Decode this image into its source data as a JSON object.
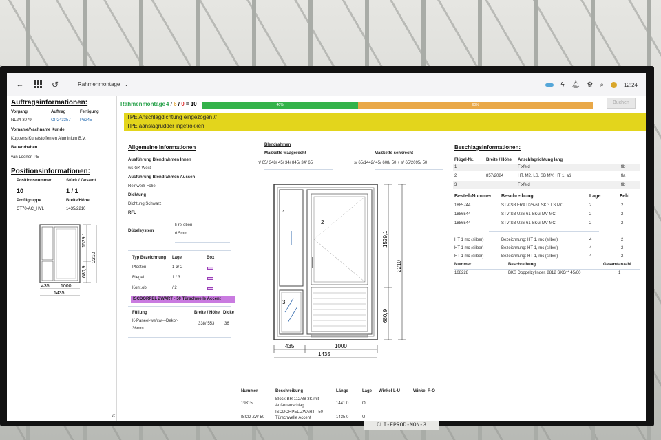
{
  "topbar": {
    "title": "Rahmenmontage",
    "time": "12:24",
    "icons": [
      "back-arrow-icon",
      "apps-grid-icon",
      "logo-icon",
      "chevron-down-icon",
      "key-icon",
      "bolt-icon",
      "bell-icon",
      "gear-icon",
      "search-icon",
      "avatar"
    ]
  },
  "left": {
    "auftrag_title": "Auftragsinformationen:",
    "vorgang_label": "Vorgang",
    "auftrag_label": "Auftrag",
    "fertigung_label": "Fertigung",
    "vorgang": "NL24-3079",
    "auftrag": "OP243357",
    "fertigung": "P6245",
    "kunde_label": "Vorname/Nachname Kunde",
    "kunde": "Kuppens Kunststoffen en Aluminium B.V.",
    "bauvorhaben_label": "Bauvorhaben",
    "bauvorhaben": "van Loenen PE",
    "position_title": "Positionsinformationen:",
    "posnr_label": "Positionsnummer",
    "stueck_label": "Stück / Gesamt",
    "posnr": "10",
    "stueck": "1 / 1",
    "profil_label": "Profilgruppe",
    "bh_label": "Breite/Höhe",
    "profil": "CT70-AC_HVL",
    "bh": "1435/2210",
    "dims": {
      "h1": "1529,1",
      "h2": "680,9",
      "total_h": "2210",
      "w1": "435",
      "w2": "1000",
      "total_w": "1435"
    }
  },
  "progress": {
    "label": "Rahmenmontage",
    "count_a": "4",
    "count_b": "6",
    "count_c": "0",
    "count_total": "10",
    "green_pct": 40,
    "green_text": "40%",
    "orange_text": "60%",
    "green_color": "#33b24a",
    "orange_color": "#e9a848",
    "buchen_label": "Buchen"
  },
  "banner": {
    "line1": "TPE Anschlagdichtung eingezogen //",
    "line2": "TPE aanslagrudder ingetrokken",
    "color": "#e3d51c"
  },
  "allgemein": {
    "title": "Allgemeine Informationen",
    "innen_label": "Ausführung Blendrahmen Innen",
    "innen": "ws-GK Weiß",
    "aussen_label": "Ausführung Blendrahmen Aussen",
    "aussen": "Reinweiß Folie",
    "dichtung_label": "Dichtung",
    "dichtung": "Dichtung Schwarz",
    "rfl_label": "RFL",
    "duebel_label": "Dübelsystem",
    "duebel_1": "li-re-oben",
    "duebel_2": "6,5mm",
    "typ_label": "Typ Bezeichnung",
    "lage_label": "Lage",
    "box_label": "Box",
    "rows": [
      {
        "typ": "Pfosten",
        "lage": "1-3/  2"
      },
      {
        "typ": "Riegel",
        "lage": "1  /  3"
      },
      {
        "typ": "Kont.ob",
        "lage": "/  2"
      }
    ],
    "purple_label": "ISCDORPEL ZWART - 50 Türschwelle Accent",
    "fuellung_label": "Füllung",
    "bh_label": "Breite / Höhe",
    "dicke_label": "Dicke",
    "fuellung_1": "K-Paneel-ws/cw---Dekor-",
    "fuellung_2": "36mm",
    "fuellung_bh": "338/ 553",
    "fuellung_dicke": "36"
  },
  "blendrahmen": {
    "title": "Blendrahmen",
    "waag_label": "Maßkette waagerecht",
    "senk_label": "Maßkette senkrecht",
    "waag": "h/ 65/ 348/ 45/ 34/ 845/ 34/ 65",
    "senk": "s/ 65/1442/ 45/ 608/ 50 + s/ 65/2095/ 50",
    "dims": {
      "h1": "1529,1",
      "h2": "680,9",
      "total_h": "2210",
      "w1": "435",
      "w2": "1000",
      "total_w": "1435",
      "f1": "1",
      "f2": "2",
      "f3": "3"
    }
  },
  "beschlag": {
    "title": "Beschlagsinformationen:",
    "h_fluegel": "Flügel-Nr.",
    "h_bh": "Breite / Höhe",
    "h_anschlag": "Anschlagrichtung lang",
    "rows1": [
      {
        "nr": "1",
        "bh": "",
        "anschlag": "Fixfeld",
        "x": "flb"
      },
      {
        "nr": "2",
        "bh": "857/2084",
        "anschlag": "HT, M2, LS, SB MV, HT 1, aö",
        "x": "fla"
      },
      {
        "nr": "3",
        "bh": "",
        "anschlag": "Fixfeld",
        "x": "flb"
      }
    ],
    "h_bestell": "Bestell-Nummer",
    "h_beschr": "Beschreibung",
    "h_lage": "Lage",
    "h_feld": "Feld",
    "rows2": [
      {
        "nr": "1885744",
        "beschr": "STV-SB FRA U26-61 SKG LS MC",
        "lage": "2",
        "feld": "2"
      },
      {
        "nr": "1886544",
        "beschr": "STV-SB U26-61 SKG MV MC",
        "lage": "2",
        "feld": "2"
      },
      {
        "nr": "1886544",
        "beschr": "STV-SB U26-61 SKG MV MC",
        "lage": "2",
        "feld": "2"
      }
    ],
    "rows3": [
      {
        "nr": "HT 1 mc (silber)",
        "beschr": "Bezeichnung: HT 1, mc (silber)",
        "lage": "4",
        "feld": "2"
      },
      {
        "nr": "HT 1 mc (silber)",
        "beschr": "Bezeichnung: HT 1, mc (silber)",
        "lage": "4",
        "feld": "2"
      },
      {
        "nr": "HT 1 mc (silber)",
        "beschr": "Bezeichnung: HT 1, mc (silber)",
        "lage": "4",
        "feld": "2"
      }
    ],
    "h_nummer": "Nummer",
    "h_beschr2": "Beschreibung",
    "h_gesamt": "Gesamtanzahl",
    "row4": {
      "nr": "168228",
      "beschr": "BKS Doppelzylinder, 8812 SKG** 45/60",
      "anzahl": "1"
    }
  },
  "bottom": {
    "h_nummer": "Nummer",
    "h_beschr": "Beschreibung",
    "h_laenge": "Länge",
    "h_lage": "Lage",
    "h_winkel_lu": "Winkel L-U",
    "h_winkel_ro": "Winkel R-O",
    "rows": [
      {
        "nr": "19315",
        "beschr1": "Block-BR 112/88 3K mit",
        "beschr2": "Außenanschlag",
        "laenge": "1441,0",
        "lage": "O"
      },
      {
        "nr": "ISCD-ZW-50",
        "beschr1": "ISCDORPEL ZWART - 50",
        "beschr2": "Türschwelle Accent",
        "laenge": "1435,0",
        "lage": "U"
      }
    ]
  },
  "monitor_label": "CLT-EPROD-MON-3"
}
